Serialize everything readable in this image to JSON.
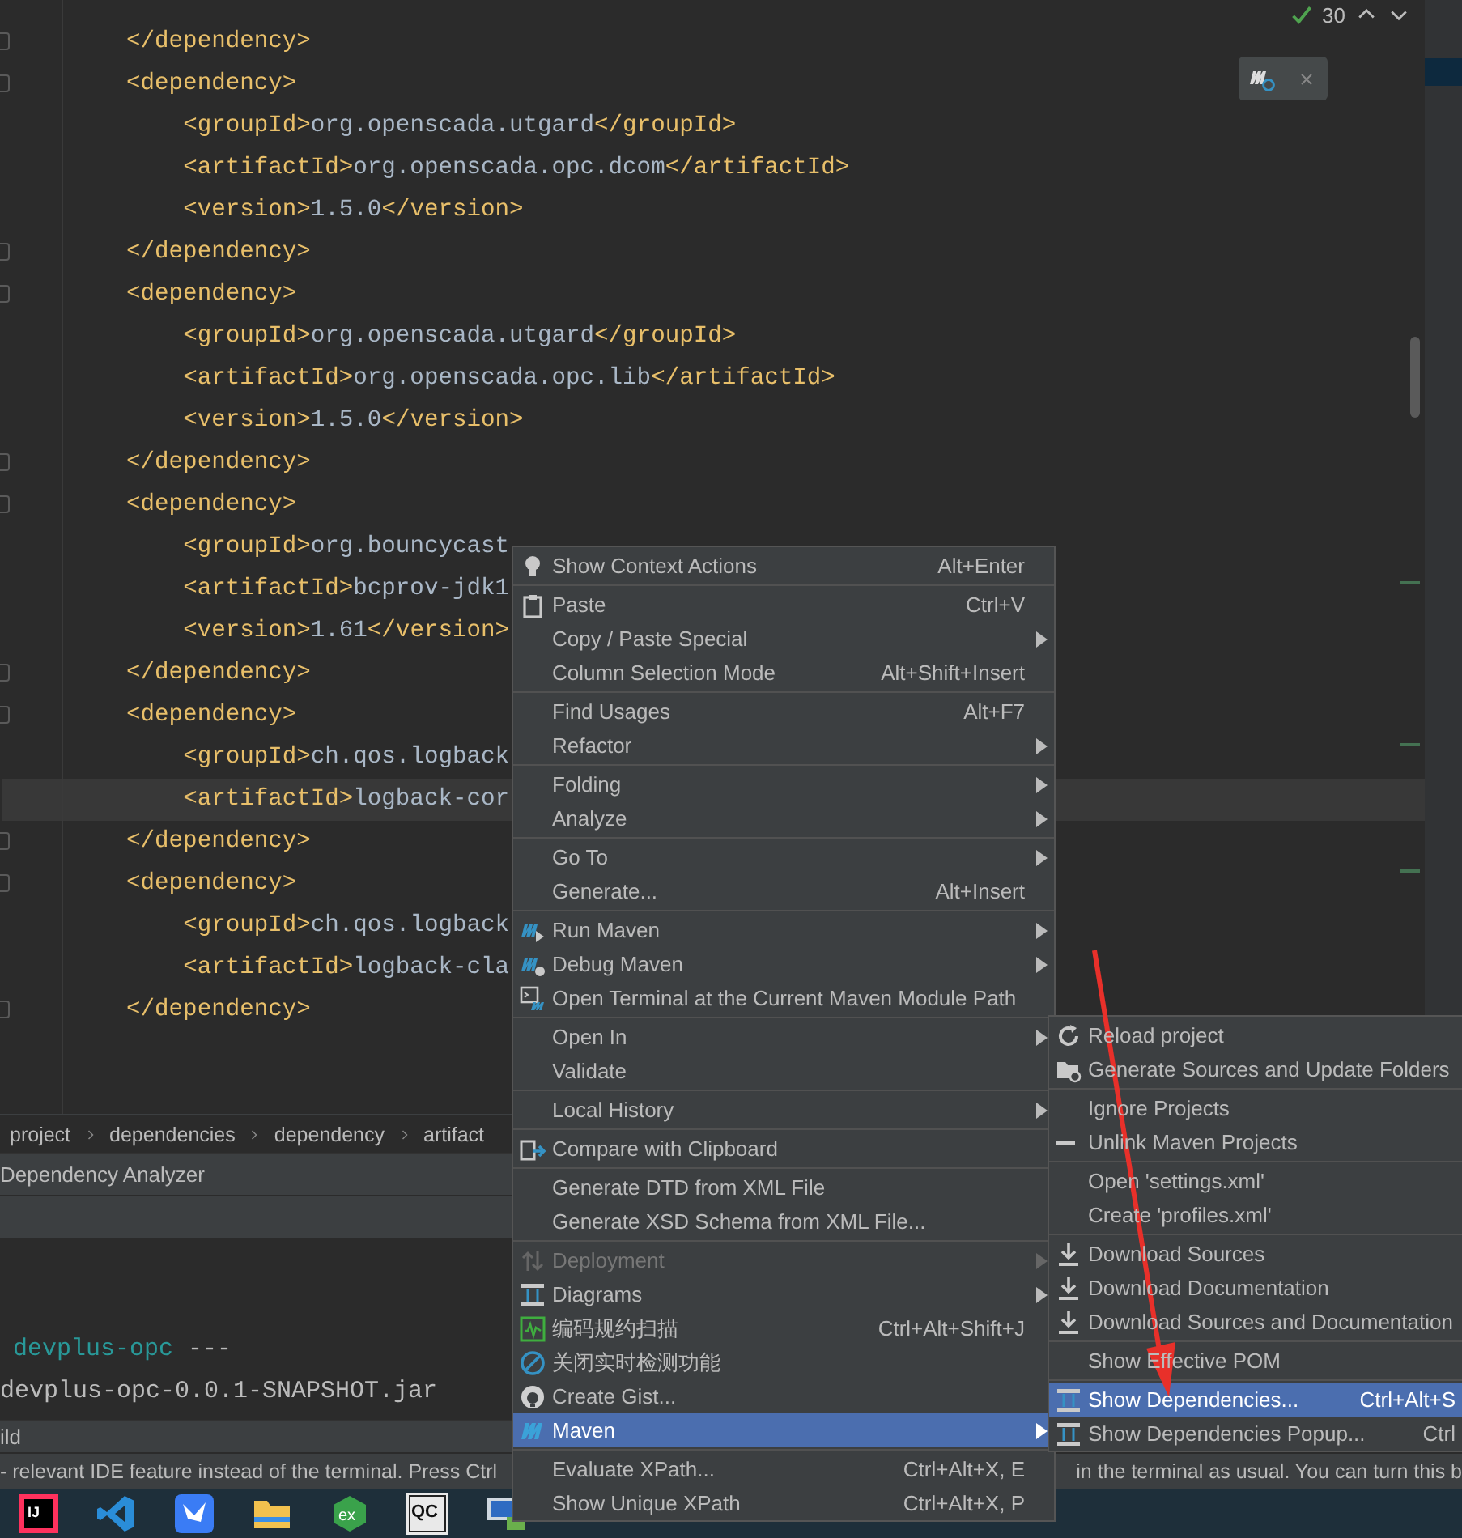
{
  "editor": {
    "inspection": {
      "count": "30"
    },
    "lines": [
      {
        "text": "    </dependency>",
        "current": false
      },
      {
        "text": "    <dependency>",
        "current": false
      },
      {
        "text": "        <groupId>org.openscada.utgard</groupId>",
        "current": false
      },
      {
        "text": "        <artifactId>org.openscada.opc.dcom</artifactId>",
        "current": false
      },
      {
        "text": "        <version>1.5.0</version>",
        "current": false
      },
      {
        "text": "    </dependency>",
        "current": false
      },
      {
        "text": "    <dependency>",
        "current": false
      },
      {
        "text": "        <groupId>org.openscada.utgard</groupId>",
        "current": false
      },
      {
        "text": "        <artifactId>org.openscada.opc.lib</artifactId>",
        "current": false
      },
      {
        "text": "        <version>1.5.0</version>",
        "current": false
      },
      {
        "text": "    </dependency>",
        "current": false
      },
      {
        "text": "    <dependency>",
        "current": false
      },
      {
        "text": "        <groupId>org.bouncycast",
        "current": false
      },
      {
        "text": "        <artifactId>bcprov-jdk1",
        "current": false
      },
      {
        "text": "        <version>1.61</version>",
        "current": false
      },
      {
        "text": "    </dependency>",
        "current": false
      },
      {
        "text": "    <dependency>",
        "current": false
      },
      {
        "text": "        <groupId>ch.qos.logback",
        "current": false
      },
      {
        "text": "        <artifactId>logback-cor",
        "current": true
      },
      {
        "text": "    </dependency>",
        "current": false
      },
      {
        "text": "    <dependency>",
        "current": false
      },
      {
        "text": "        <groupId>ch.qos.logback",
        "current": false
      },
      {
        "text": "        <artifactId>logback-cla",
        "current": false
      },
      {
        "text": "    </dependency>",
        "current": false
      }
    ]
  },
  "breadcrumbs": [
    "project",
    "dependencies",
    "dependency",
    "artifact"
  ],
  "tool_window": {
    "title": "Dependency Analyzer"
  },
  "console": {
    "lines": [
      {
        "kind": "module",
        "text": "devplus-opc",
        "tail": " ---"
      },
      {
        "kind": "plain",
        "text": "devplus-opc-0.0.1-SNAPSHOT.jar"
      }
    ]
  },
  "build_tab": "ild",
  "hint": {
    "left": "- relevant IDE feature instead of the terminal. Press Ctrl",
    "right": "in the terminal as usual. You can turn this b"
  },
  "context_menu": {
    "groups": [
      {
        "items": [
          {
            "label": "Show Context Actions",
            "shortcut": "Alt+Enter",
            "submenu": false,
            "disabled": false,
            "selected": false
          }
        ]
      },
      {
        "items": [
          {
            "label": "Paste",
            "shortcut": "Ctrl+V",
            "submenu": false,
            "disabled": false,
            "selected": false
          },
          {
            "label": "Copy / Paste Special",
            "submenu": true,
            "disabled": false,
            "selected": false
          },
          {
            "label": "Column Selection Mode",
            "shortcut": "Alt+Shift+Insert",
            "submenu": false,
            "disabled": false,
            "selected": false
          }
        ]
      },
      {
        "items": [
          {
            "label": "Find Usages",
            "shortcut": "Alt+F7",
            "submenu": false,
            "disabled": false,
            "selected": false
          },
          {
            "label": "Refactor",
            "submenu": true,
            "disabled": false,
            "selected": false
          }
        ]
      },
      {
        "items": [
          {
            "label": "Folding",
            "submenu": true,
            "disabled": false,
            "selected": false
          },
          {
            "label": "Analyze",
            "submenu": true,
            "disabled": false,
            "selected": false
          }
        ]
      },
      {
        "items": [
          {
            "label": "Go To",
            "submenu": true,
            "disabled": false,
            "selected": false
          },
          {
            "label": "Generate...",
            "shortcut": "Alt+Insert",
            "submenu": false,
            "disabled": false,
            "selected": false
          }
        ]
      },
      {
        "items": [
          {
            "label": "Run Maven",
            "submenu": true,
            "disabled": false,
            "selected": false
          },
          {
            "label": "Debug Maven",
            "submenu": true,
            "disabled": false,
            "selected": false
          },
          {
            "label": "Open Terminal at the Current Maven Module Path",
            "submenu": false,
            "disabled": false,
            "selected": false
          }
        ]
      },
      {
        "items": [
          {
            "label": "Open In",
            "submenu": true,
            "disabled": false,
            "selected": false
          },
          {
            "label": "Validate",
            "submenu": false,
            "disabled": false,
            "selected": false
          }
        ]
      },
      {
        "items": [
          {
            "label": "Local History",
            "submenu": true,
            "disabled": false,
            "selected": false
          }
        ]
      },
      {
        "items": [
          {
            "label": "Compare with Clipboard",
            "submenu": false,
            "disabled": false,
            "selected": false
          }
        ]
      },
      {
        "items": [
          {
            "label": "Generate DTD from XML File",
            "submenu": false,
            "disabled": false,
            "selected": false
          },
          {
            "label": "Generate XSD Schema from XML File...",
            "submenu": false,
            "disabled": false,
            "selected": false
          }
        ]
      },
      {
        "items": [
          {
            "label": "Deployment",
            "submenu": true,
            "disabled": true,
            "selected": false
          },
          {
            "label": "Diagrams",
            "submenu": true,
            "disabled": false,
            "selected": false
          },
          {
            "label": "编码规约扫描",
            "shortcut": "Ctrl+Alt+Shift+J",
            "submenu": false,
            "disabled": false,
            "selected": false
          },
          {
            "label": "关闭实时检测功能",
            "submenu": false,
            "disabled": false,
            "selected": false
          },
          {
            "label": "Create Gist...",
            "submenu": false,
            "disabled": false,
            "selected": false
          },
          {
            "label": "Maven",
            "submenu": true,
            "disabled": false,
            "selected": true
          }
        ]
      },
      {
        "items": [
          {
            "label": "Evaluate XPath...",
            "shortcut": "Ctrl+Alt+X, E",
            "submenu": false,
            "disabled": false,
            "selected": false
          },
          {
            "label": "Show Unique XPath",
            "shortcut": "Ctrl+Alt+X, P",
            "submenu": false,
            "disabled": false,
            "selected": false
          }
        ]
      }
    ]
  },
  "maven_submenu": {
    "groups": [
      {
        "items": [
          {
            "label": "Reload project",
            "selected": false
          },
          {
            "label": "Generate Sources and Update Folders",
            "selected": false
          }
        ]
      },
      {
        "items": [
          {
            "label": "Ignore Projects",
            "selected": false
          },
          {
            "label": "Unlink Maven Projects",
            "selected": false
          }
        ]
      },
      {
        "items": [
          {
            "label": "Open 'settings.xml'",
            "selected": false
          },
          {
            "label": "Create 'profiles.xml'",
            "selected": false
          }
        ]
      },
      {
        "items": [
          {
            "label": "Download Sources",
            "selected": false
          },
          {
            "label": "Download Documentation",
            "selected": false
          },
          {
            "label": "Download Sources and Documentation",
            "selected": false
          }
        ]
      },
      {
        "items": [
          {
            "label": "Show Effective POM",
            "selected": false
          }
        ]
      },
      {
        "items": [
          {
            "label": "Show Dependencies...",
            "shortcut": "Ctrl+Alt+S",
            "selected": true
          },
          {
            "label": "Show Dependencies Popup...",
            "shortcut": "Ctrl",
            "selected": false
          }
        ]
      }
    ]
  },
  "taskbar": {
    "apps": [
      {
        "kind": "ide",
        "label": "IJ"
      },
      {
        "kind": "editor"
      },
      {
        "kind": "bird"
      },
      {
        "kind": "folder"
      },
      {
        "kind": "badge",
        "label": "ex"
      },
      {
        "kind": "card",
        "label": "QC"
      },
      {
        "kind": "monitor"
      }
    ]
  }
}
